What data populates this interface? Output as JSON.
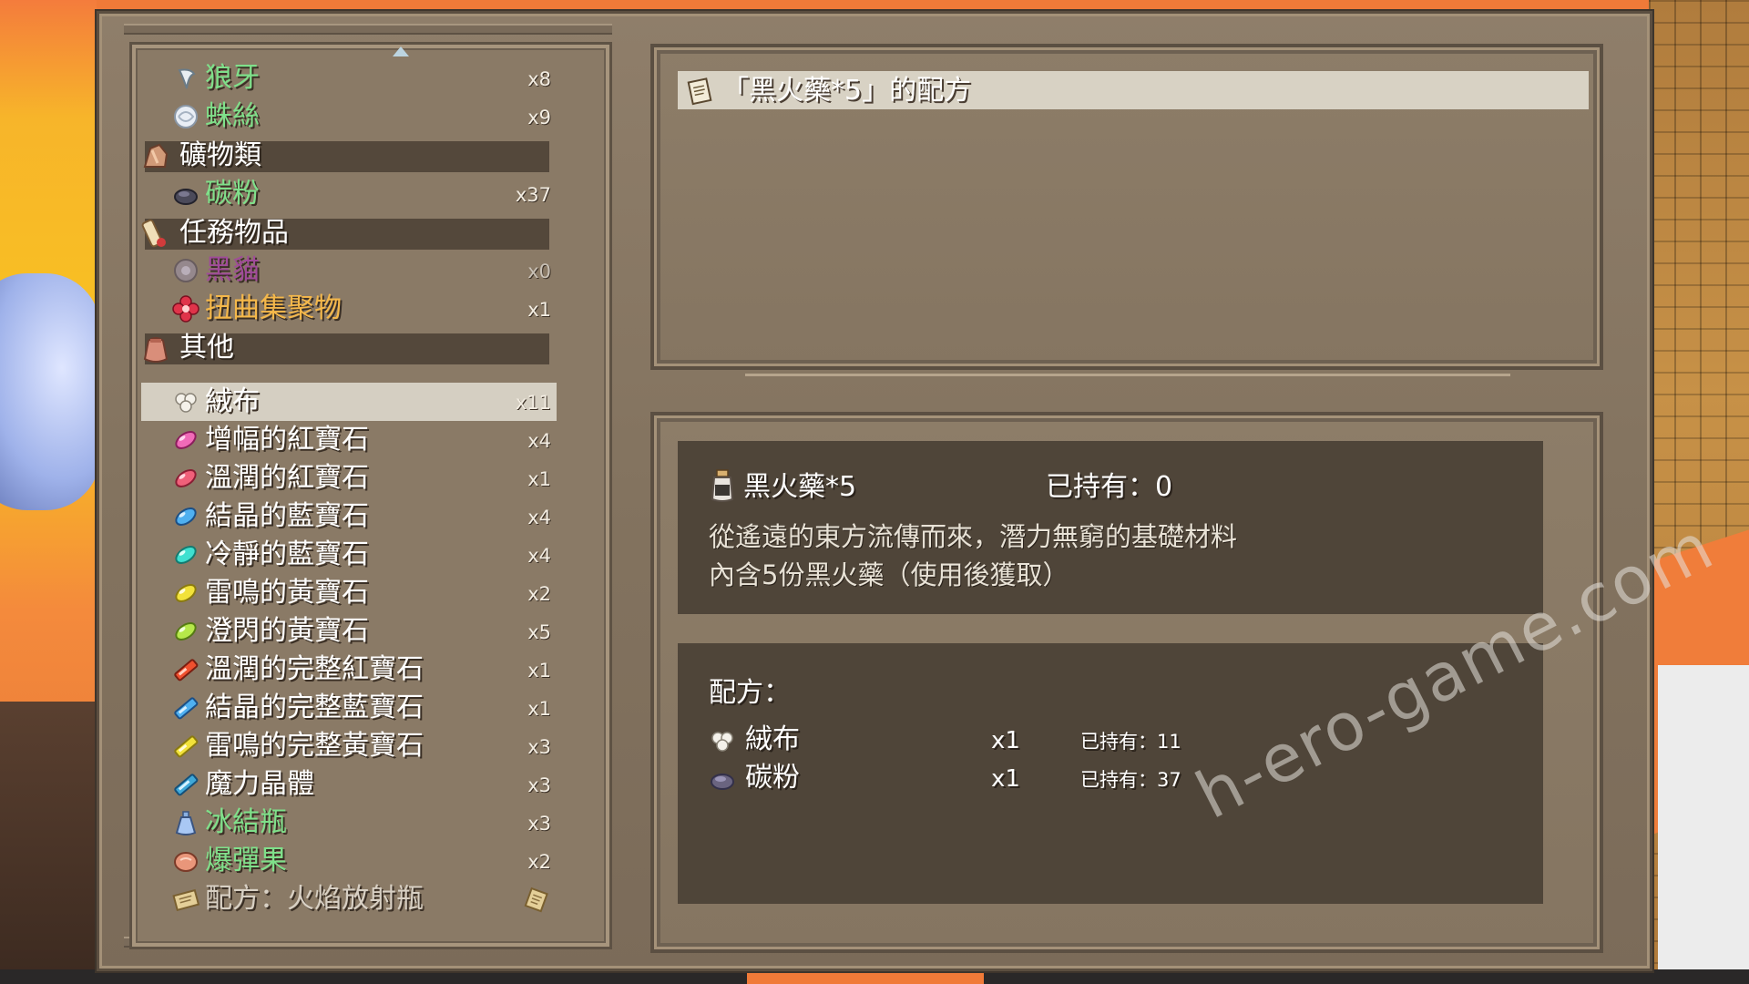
{
  "items_list": {
    "rows": [
      {
        "type": "item",
        "icon": "fang-icon",
        "name": "狼牙",
        "qty": "x8",
        "color": "#7fe08a"
      },
      {
        "type": "item",
        "icon": "spider-silk-icon",
        "name": "蛛絲",
        "qty": "x9",
        "color": "#7fe08a"
      },
      {
        "type": "category",
        "icon": "ore-icon",
        "name": "礦物類"
      },
      {
        "type": "item",
        "icon": "carbon-powder-icon",
        "name": "碳粉",
        "qty": "x37",
        "color": "#7fe08a"
      },
      {
        "type": "category",
        "icon": "quest-scroll-icon",
        "name": "任務物品"
      },
      {
        "type": "item",
        "icon": "dark-crest-icon",
        "name": "黑貓",
        "qty": "x0",
        "color": "#a04a9a"
      },
      {
        "type": "item",
        "icon": "red-flower-icon",
        "name": "扭曲集聚物",
        "qty": "x1",
        "color": "#f5b84a"
      },
      {
        "type": "category",
        "icon": "pouch-icon",
        "name": "其他"
      },
      {
        "type": "item",
        "icon": "cotton-icon",
        "name": "絨布",
        "qty": "x11",
        "color": "#ffffff",
        "selected": true
      },
      {
        "type": "item",
        "icon": "pink-gem-icon",
        "name": "增幅的紅寶石",
        "qty": "x4",
        "color": "#ffffff"
      },
      {
        "type": "item",
        "icon": "pink-gem-icon",
        "name": "溫潤的紅寶石",
        "qty": "x1",
        "color": "#ffffff"
      },
      {
        "type": "item",
        "icon": "blue-gem-icon",
        "name": "結晶的藍寶石",
        "qty": "x4",
        "color": "#ffffff"
      },
      {
        "type": "item",
        "icon": "cyan-gem-icon",
        "name": "冷靜的藍寶石",
        "qty": "x4",
        "color": "#ffffff"
      },
      {
        "type": "item",
        "icon": "yellow-gem-icon",
        "name": "雷鳴的黃寶石",
        "qty": "x2",
        "color": "#ffffff"
      },
      {
        "type": "item",
        "icon": "yellow-green-gem-icon",
        "name": "澄閃的黃寶石",
        "qty": "x5",
        "color": "#ffffff"
      },
      {
        "type": "item",
        "icon": "red-bar-gem-icon",
        "name": "溫潤的完整紅寶石",
        "qty": "x1",
        "color": "#ffffff"
      },
      {
        "type": "item",
        "icon": "blue-bar-gem-icon",
        "name": "結晶的完整藍寶石",
        "qty": "x1",
        "color": "#ffffff"
      },
      {
        "type": "item",
        "icon": "yellow-bar-gem-icon",
        "name": "雷鳴的完整黃寶石",
        "qty": "x3",
        "color": "#ffffff"
      },
      {
        "type": "item",
        "icon": "magic-crystal-icon",
        "name": "魔力晶體",
        "qty": "x3",
        "color": "#ffffff"
      },
      {
        "type": "item",
        "icon": "frozen-bottle-icon",
        "name": "冰結瓶",
        "qty": "x3",
        "color": "#7fe08a"
      },
      {
        "type": "item",
        "icon": "bomb-fruit-icon",
        "name": "爆彈果",
        "qty": "x2",
        "color": "#7fe08a"
      },
      {
        "type": "item",
        "icon": "recipe-scroll-icon",
        "name": "配方：火焰放射瓶",
        "qty": "",
        "color": "#d8d0c4",
        "trailing_icon": "recipe-scroll-icon"
      }
    ]
  },
  "recipe_title": {
    "icon": "recipe-scroll-icon",
    "text": "「黑火藥*5」的配方"
  },
  "detail": {
    "product_icon": "black-powder-jar-icon",
    "product_name": "黑火藥*5",
    "owned_label": "已持有：0",
    "description_line1": "從遙遠的東方流傳而來，潛力無窮的基礎材料",
    "description_line2": "內含5份黑火藥（使用後獲取）"
  },
  "recipe": {
    "label": "配方：",
    "ingredients": [
      {
        "icon": "cotton-icon",
        "name": "絨布",
        "qty": "x1",
        "owned": "已持有：11"
      },
      {
        "icon": "carbon-powder-icon",
        "name": "碳粉",
        "qty": "x1",
        "owned": "已持有：37"
      }
    ]
  },
  "watermark": "h-ero-game.com"
}
